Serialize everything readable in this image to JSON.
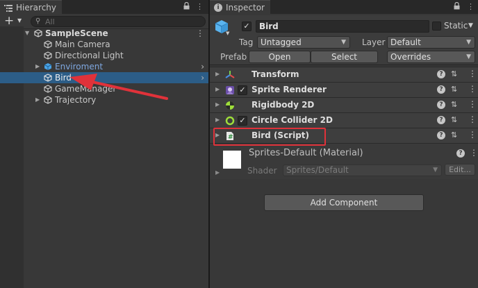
{
  "hierarchy": {
    "tab_label": "Hierarchy",
    "search_placeholder": "All",
    "scene_name": "SampleScene",
    "items": [
      {
        "label": "Main Camera",
        "expandable": false,
        "selected": false
      },
      {
        "label": "Directional Light",
        "expandable": false,
        "selected": false
      },
      {
        "label": "Enviroment",
        "expandable": true,
        "selected": false,
        "prefab": true
      },
      {
        "label": "Bird",
        "expandable": false,
        "selected": true
      },
      {
        "label": "GameManager",
        "expandable": false,
        "selected": false
      },
      {
        "label": "Trajectory",
        "expandable": true,
        "selected": false
      }
    ]
  },
  "inspector": {
    "tab_label": "Inspector",
    "object_name": "Bird",
    "static_label": "Static",
    "tag_label": "Tag",
    "tag_value": "Untagged",
    "layer_label": "Layer",
    "layer_value": "Default",
    "prefab_label": "Prefab",
    "open_label": "Open",
    "select_label": "Select",
    "overrides_label": "Overrides",
    "components": [
      {
        "name": "Transform",
        "icon": "transform-icon",
        "has_checkbox": false
      },
      {
        "name": "Sprite Renderer",
        "icon": "sprite-renderer-icon",
        "has_checkbox": true
      },
      {
        "name": "Rigidbody 2D",
        "icon": "rigidbody-icon",
        "has_checkbox": false
      },
      {
        "name": "Circle Collider 2D",
        "icon": "circle-collider-icon",
        "has_checkbox": true
      },
      {
        "name": "Bird (Script)",
        "icon": "script-icon",
        "has_checkbox": false
      }
    ],
    "material": {
      "name": "Sprites-Default (Material)",
      "shader_label": "Shader",
      "shader_value": "Sprites/Default",
      "edit_label": "Edit..."
    },
    "add_component_label": "Add Component"
  },
  "colors": {
    "selection": "#2c5d87",
    "annotation": "#e0323a",
    "prefab_text": "#7fa8e0"
  }
}
